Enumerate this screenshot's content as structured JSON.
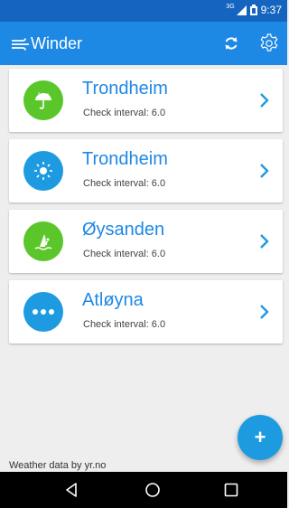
{
  "status": {
    "network": "3G",
    "time": "9:37"
  },
  "app_bar": {
    "title": "Winder",
    "refresh_icon": "refresh-icon",
    "settings_icon": "gear-icon"
  },
  "colors": {
    "primary": "#1e88e5",
    "primary_dark": "#1565c0",
    "green": "#5ac62a",
    "blue": "#1e9be0"
  },
  "locations": [
    {
      "name": "Trondheim",
      "interval": "Check interval:  6.0",
      "icon": "umbrella-icon",
      "icon_color": "#5ac62a"
    },
    {
      "name": "Trondheim",
      "interval": "Check interval:  6.0",
      "icon": "sun-icon",
      "icon_color": "#1e9be0"
    },
    {
      "name": "Øysanden",
      "interval": "Check interval:  6.0",
      "icon": "windsurf-icon",
      "icon_color": "#5ac62a"
    },
    {
      "name": "Atløyna",
      "interval": "Check interval:  6.0",
      "icon": "more-icon",
      "icon_color": "#1e9be0"
    }
  ],
  "fab": {
    "label": "+"
  },
  "footer": {
    "credit": "Weather data by yr.no"
  },
  "nav": {
    "back": "back-icon",
    "home": "home-icon",
    "recents": "recents-icon"
  }
}
